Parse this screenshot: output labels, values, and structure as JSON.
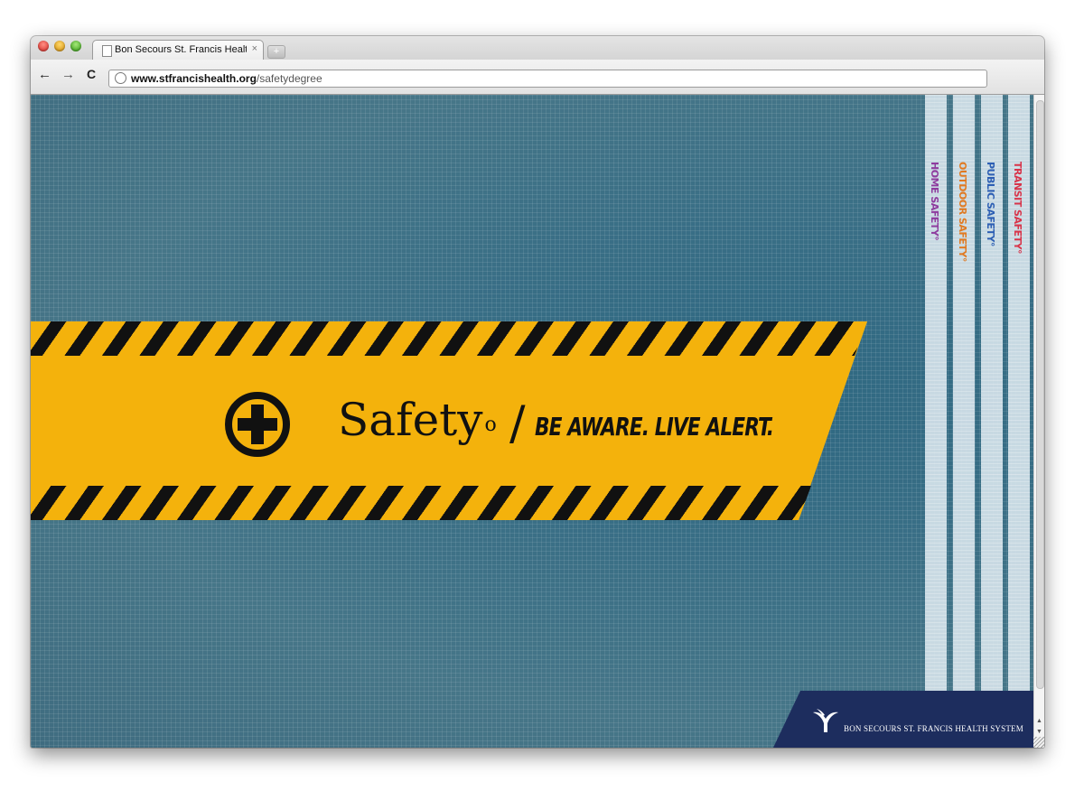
{
  "browser": {
    "tab_title": "Bon Secours St. Francis Healt",
    "tab_close": "×",
    "new_tab": "+",
    "nav": {
      "back": "←",
      "forward": "→",
      "reload": "C"
    },
    "url_host": "www.stfrancishealth.org",
    "url_path": "/safetydegree"
  },
  "page": {
    "brand_word": "Safety",
    "brand_degree": "o",
    "slash": "/",
    "tagline": "BE AWARE. LIVE ALERT.",
    "side_nav": [
      {
        "label": "HOME SAFETY°",
        "color": "#8e3c9e"
      },
      {
        "label": "OUTDOOR SAFETY°",
        "color": "#e07a22"
      },
      {
        "label": "PUBLIC SAFETY°",
        "color": "#2d5fb4"
      },
      {
        "label": "TRANSIT SAFETY°",
        "color": "#d8344a"
      }
    ],
    "footer_org": "BON SECOURS ST. FRANCIS HEALTH SYSTEM"
  },
  "colors": {
    "banner_yellow": "#f4b20c",
    "footer_navy": "#1d2d5e",
    "background_teal": "#3a6f86"
  }
}
